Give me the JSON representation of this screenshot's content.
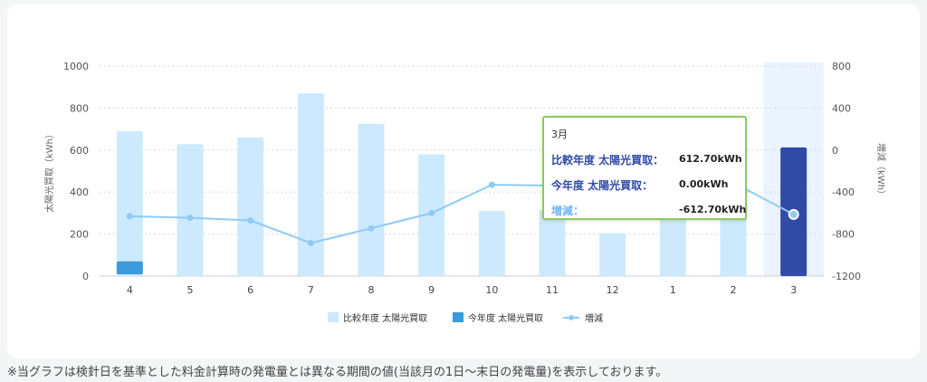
{
  "chart_data": {
    "type": "bar",
    "categories": [
      "4",
      "5",
      "6",
      "7",
      "8",
      "9",
      "10",
      "11",
      "12",
      "1",
      "2",
      "3"
    ],
    "title": "",
    "ylabel_left": "太陽光買取（kWh）",
    "ylabel_right": "増減（kWh）",
    "left_axis": {
      "ylim": [
        0,
        1000
      ],
      "ticks": [
        "0",
        "200",
        "400",
        "600",
        "800",
        "1000"
      ]
    },
    "right_axis": {
      "ylim": [
        -1200,
        800
      ],
      "ticks": [
        "-1200",
        "-800",
        "-400",
        "0",
        "400",
        "800"
      ]
    },
    "grid": true,
    "legend_position": "bottom-center",
    "highlighted_category": "3",
    "series": [
      {
        "name": "比較年度 太陽光買取",
        "type": "bar",
        "axis": "left",
        "color": "#cde9fd",
        "values": [
          690,
          628,
          660,
          870,
          725,
          580,
          310,
          315,
          205,
          290,
          300,
          612.7
        ]
      },
      {
        "name": "今年度 太陽光買取",
        "type": "bar",
        "axis": "left",
        "color": "#3b9ad9",
        "highlight_color": "#2f4ba5",
        "values": [
          70,
          0,
          0,
          0,
          0,
          0,
          0,
          0,
          0,
          0,
          0,
          0
        ]
      },
      {
        "name": "増減",
        "type": "line",
        "axis": "right",
        "color": "#8ecbf5",
        "values": [
          -630,
          -645,
          -670,
          -885,
          -745,
          -600,
          -330,
          -338,
          -210,
          -300,
          -310,
          -612.7
        ]
      }
    ]
  },
  "tooltip": {
    "month": "3月",
    "compare_label": "比較年度 太陽光買取：",
    "compare_value": "612.70kWh",
    "current_label": "今年度 太陽光買取：",
    "current_value": "0.00kWh",
    "diff_label": "増減：",
    "diff_value": "-612.70kWh"
  },
  "footnote": "※当グラフは検針日を基準とした料金計算時の発電量とは異なる期間の値(当該月の1日～末日の発電量)を表示しております。"
}
